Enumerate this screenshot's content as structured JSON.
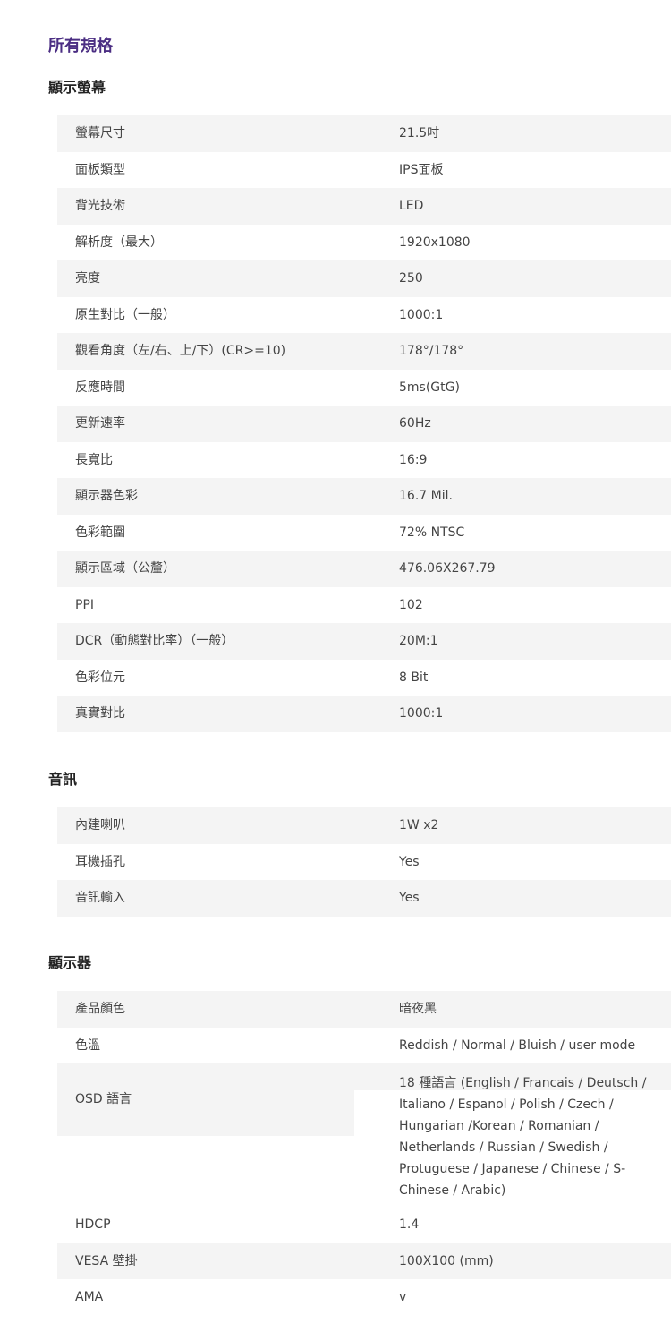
{
  "page_title": "所有規格",
  "sections": [
    {
      "title": "顯示螢幕",
      "rows": [
        {
          "key": "螢幕尺寸",
          "value": "21.5吋"
        },
        {
          "key": "面板類型",
          "value": "IPS面板"
        },
        {
          "key": "背光技術",
          "value": "LED"
        },
        {
          "key": "解析度（最大）",
          "value": "1920x1080"
        },
        {
          "key": "亮度",
          "value": "250"
        },
        {
          "key": "原生對比（一般）",
          "value": "1000:1"
        },
        {
          "key": "觀看角度（左/右、上/下）(CR>=10)",
          "value": "178°/178°"
        },
        {
          "key": "反應時間",
          "value": "5ms(GtG)"
        },
        {
          "key": "更新速率",
          "value": "60Hz"
        },
        {
          "key": "長寬比",
          "value": "16:9"
        },
        {
          "key": "顯示器色彩",
          "value": "16.7 Mil."
        },
        {
          "key": "色彩範圍",
          "value": "72% NTSC"
        },
        {
          "key": "顯示區域（公釐）",
          "value": "476.06X267.79"
        },
        {
          "key": "PPI",
          "value": "102"
        },
        {
          "key": "DCR（動態對比率）（一般）",
          "value": "20M:1"
        },
        {
          "key": "色彩位元",
          "value": "8 Bit"
        },
        {
          "key": "真實對比",
          "value": "1000:1"
        }
      ]
    },
    {
      "title": "音訊",
      "rows": [
        {
          "key": "內建喇叭",
          "value": "1W x2"
        },
        {
          "key": "耳機插孔",
          "value": "Yes"
        },
        {
          "key": "音訊輸入",
          "value": "Yes"
        }
      ]
    },
    {
      "title": "顯示器",
      "rows": [
        {
          "key": "產品顏色",
          "value": "暗夜黑"
        },
        {
          "key": "色溫",
          "value": "Reddish / Normal / Bluish / user mode"
        },
        {
          "key": "OSD 語言",
          "value": "18 種語言 (English / Francais / Deutsch / Italiano / Espanol / Polish / Czech / Hungarian /Korean / Romanian / Netherlands / Russian / Swedish / Protuguese / Japanese / Chinese / S-Chinese / Arabic)"
        },
        {
          "key": "HDCP",
          "value": "1.4"
        },
        {
          "key": "VESA 壁掛",
          "value": "100X100 (mm)"
        },
        {
          "key": "AMA",
          "value": "v"
        }
      ]
    }
  ]
}
